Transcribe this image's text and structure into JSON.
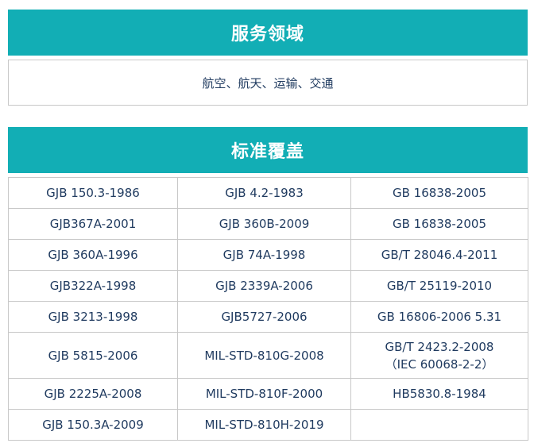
{
  "service": {
    "title": "服务领域",
    "content": "航空、航天、运输、交通"
  },
  "standards": {
    "title": "标准覆盖",
    "rows": [
      [
        "GJB 150.3-1986",
        "GJB 4.2-1983",
        "GB 16838-2005"
      ],
      [
        "GJB367A-2001",
        "GJB 360B-2009",
        "GB 16838-2005"
      ],
      [
        "GJB 360A-1996",
        "GJB 74A-1998",
        "GB/T 28046.4-2011"
      ],
      [
        "GJB322A-1998",
        "GJB 2339A-2006",
        "GB/T 25119-2010"
      ],
      [
        "GJB 3213-1998",
        "GJB5727-2006",
        "GB 16806-2006 5.31"
      ],
      [
        "GJB 5815-2006",
        "MIL-STD-810G-2008",
        "GB/T 2423.2-2008",
        "（IEC 60068-2-2）"
      ],
      [
        "GJB 2225A-2008",
        "MIL-STD-810F-2000",
        "HB5830.8-1984"
      ],
      [
        "GJB 150.3A-2009",
        "MIL-STD-810H-2019",
        ""
      ]
    ]
  },
  "colors": {
    "header_bg": "#12aeb5",
    "header_text": "#ffffff",
    "body_text": "#1f3a5f",
    "border": "#c8c8c8"
  }
}
